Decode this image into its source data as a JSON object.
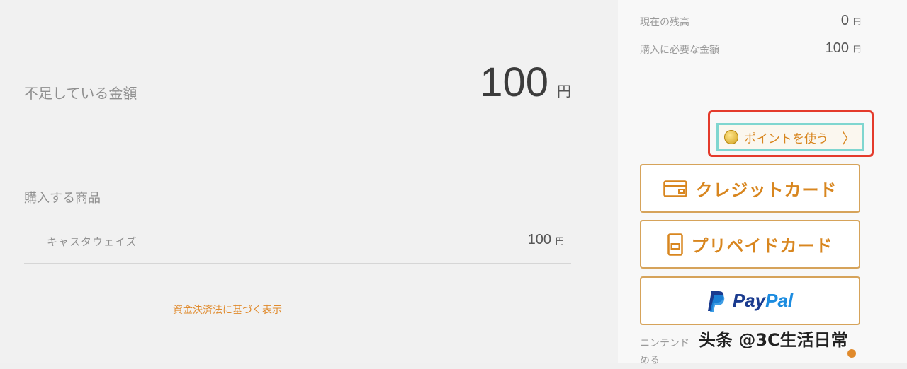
{
  "summary": {
    "balance_label": "現在の残高",
    "balance_value": "0",
    "balance_unit": "円",
    "required_label": "購入に必要な金額",
    "required_value": "100",
    "required_unit": "円"
  },
  "shortage": {
    "label": "不足している金額",
    "amount": "100",
    "unit": "円"
  },
  "purchase": {
    "label": "購入する商品",
    "items": [
      {
        "name": "キャスタウェイズ",
        "price": "100",
        "unit": "円"
      }
    ]
  },
  "law_link": "資金決済法に基づく表示",
  "points": {
    "label": "ポイントを使う",
    "chevron": "〉"
  },
  "payment_methods": {
    "credit": "クレジットカード",
    "prepaid": "プリペイドカード",
    "paypal": {
      "pay": "Pay",
      "pal": "Pal"
    }
  },
  "footer": {
    "line1": "ニンテンド",
    "line2": "める"
  },
  "watermark": "头条 @3C生活日常",
  "colors": {
    "accent": "#e08a2c",
    "highlight_outline": "#e43b2c",
    "focus_ring": "#7fd6d0",
    "paypal_dark": "#1a3b8f",
    "paypal_light": "#1c8ce0"
  },
  "icons": {
    "points": "coin-icon",
    "credit": "credit-card-icon",
    "prepaid": "prepaid-card-icon",
    "paypal": "paypal-logo-icon"
  }
}
